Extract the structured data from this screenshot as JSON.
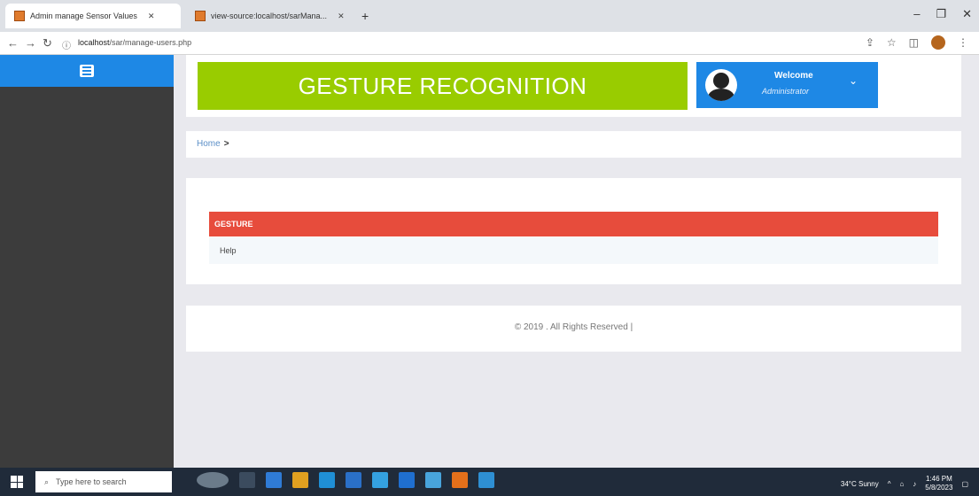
{
  "browser": {
    "tabs": [
      {
        "title": "Admin manage Sensor Values",
        "active": true
      },
      {
        "title": "view-source:localhost/sarMana...",
        "active": false
      }
    ],
    "new_tab": "+",
    "address": {
      "host": "localhost",
      "path": "/sar/manage-users.php"
    },
    "window_controls": {
      "minimize": "–",
      "maximize": "❐",
      "close": "✕"
    }
  },
  "sidebar": {
    "menu_icon": "hamburger-icon",
    "accent": "#1e88e5"
  },
  "header": {
    "title": "GESTURE RECOGNITION",
    "title_bg": "#99cc00",
    "welcome": "Welcome",
    "username": "Administrator",
    "user_bg": "#1e88e5"
  },
  "breadcrumb": {
    "home": "Home",
    "separator": ">"
  },
  "table": {
    "header": "GESTURE",
    "header_bg": "#e74c3c",
    "rows": [
      {
        "value": "Help"
      }
    ]
  },
  "footer": {
    "text": "© 2019 . All Rights Reserved |"
  },
  "taskbar": {
    "search_placeholder": "Type here to search",
    "weather": "34°C Sunny",
    "time": "1:46 PM",
    "date": "5/8/2023"
  }
}
